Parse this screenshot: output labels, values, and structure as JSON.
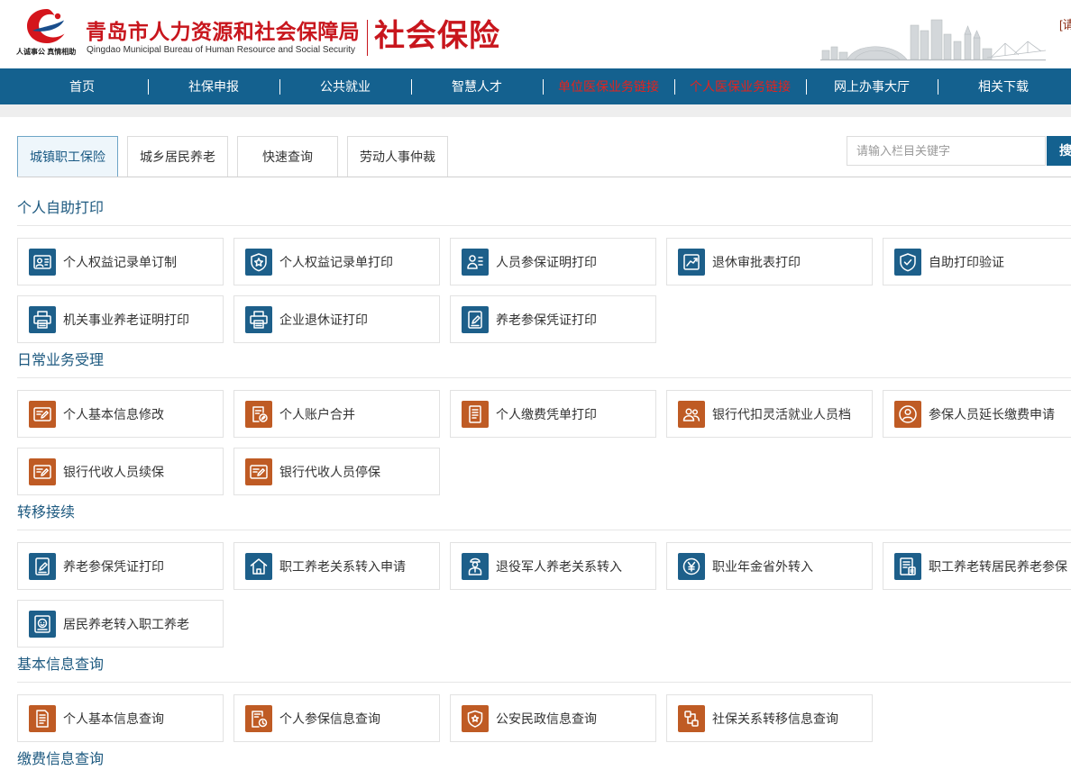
{
  "header": {
    "logo_icon": "bureau-logo-icon",
    "slogan": "人诚事公 真情相助",
    "bureau_name_cn": "青岛市人力资源和社会保障局",
    "bureau_name_en": "Qingdao Municipal Bureau of Human Resource and Social Security",
    "site_title": "社会保险",
    "skyline_icon": "city-skyline-icon",
    "login_link": "[请"
  },
  "colors": {
    "primary": "#14618f",
    "brand_red": "#c8161d",
    "nav_highlight": "#e4231d",
    "icon_blue": "#1d5f8a",
    "icon_orange": "#bf5b24",
    "section_title": "#1e5a80"
  },
  "nav": {
    "items": [
      {
        "label": "首页",
        "highlight": false
      },
      {
        "label": "社保申报",
        "highlight": false
      },
      {
        "label": "公共就业",
        "highlight": false
      },
      {
        "label": "智慧人才",
        "highlight": false
      },
      {
        "label": "单位医保业务链接",
        "highlight": true
      },
      {
        "label": "个人医保业务链接",
        "highlight": true
      },
      {
        "label": "网上办事大厅",
        "highlight": false
      },
      {
        "label": "相关下载",
        "highlight": false
      }
    ]
  },
  "tabs": [
    {
      "label": "城镇职工保险",
      "active": true
    },
    {
      "label": "城乡居民养老",
      "active": false
    },
    {
      "label": "快速查询",
      "active": false
    },
    {
      "label": "劳动人事仲裁",
      "active": false
    }
  ],
  "search": {
    "placeholder": "请输入栏目关键字",
    "value": "",
    "button_label": "搜"
  },
  "sections": [
    {
      "title": "个人自助打印",
      "icon_color": "#1d5f8a",
      "items": [
        {
          "label": "个人权益记录单订制",
          "icon": "id-card-icon"
        },
        {
          "label": "个人权益记录单打印",
          "icon": "shield-star-icon"
        },
        {
          "label": "人员参保证明打印",
          "icon": "person-document-icon"
        },
        {
          "label": "退休审批表打印",
          "icon": "trend-chart-icon"
        },
        {
          "label": "自助打印验证",
          "icon": "shield-verify-icon"
        },
        {
          "label": "机关事业养老证明打印",
          "icon": "printer-icon"
        },
        {
          "label": "企业退休证打印",
          "icon": "printer-icon"
        },
        {
          "label": "养老参保凭证打印",
          "icon": "certificate-edit-icon"
        }
      ]
    },
    {
      "title": "日常业务受理",
      "icon_color": "#bf5b24",
      "items": [
        {
          "label": "个人基本信息修改",
          "icon": "form-edit-icon"
        },
        {
          "label": "个人账户合并",
          "icon": "document-edit-icon"
        },
        {
          "label": "个人缴费凭单打印",
          "icon": "receipt-icon"
        },
        {
          "label": "银行代扣灵活就业人员档",
          "icon": "people-group-icon"
        },
        {
          "label": "参保人员延长缴费申请",
          "icon": "person-circle-icon"
        },
        {
          "label": "银行代收人员续保",
          "icon": "form-edit-icon"
        },
        {
          "label": "银行代收人员停保",
          "icon": "form-edit-icon"
        }
      ]
    },
    {
      "title": "转移接续",
      "icon_color": "#1d5f8a",
      "items": [
        {
          "label": "养老参保凭证打印",
          "icon": "certificate-edit-icon"
        },
        {
          "label": "职工养老关系转入申请",
          "icon": "home-transfer-icon"
        },
        {
          "label": "退役军人养老关系转入",
          "icon": "veteran-icon"
        },
        {
          "label": "职业年金省外转入",
          "icon": "annuity-icon"
        },
        {
          "label": "职工养老转居民养老参保",
          "icon": "document-list-icon"
        },
        {
          "label": "居民养老转入职工养老",
          "icon": "resident-card-icon"
        }
      ]
    },
    {
      "title": "基本信息查询",
      "icon_color": "#bf5b24",
      "items": [
        {
          "label": "个人基本信息查询",
          "icon": "document-icon"
        },
        {
          "label": "个人参保信息查询",
          "icon": "document-clock-icon"
        },
        {
          "label": "公安民政信息查询",
          "icon": "police-badge-icon"
        },
        {
          "label": "社保关系转移信息查询",
          "icon": "transfer-flow-icon"
        }
      ]
    },
    {
      "title": "缴费信息查询",
      "icon_color": "#bf5b24",
      "items": []
    }
  ]
}
